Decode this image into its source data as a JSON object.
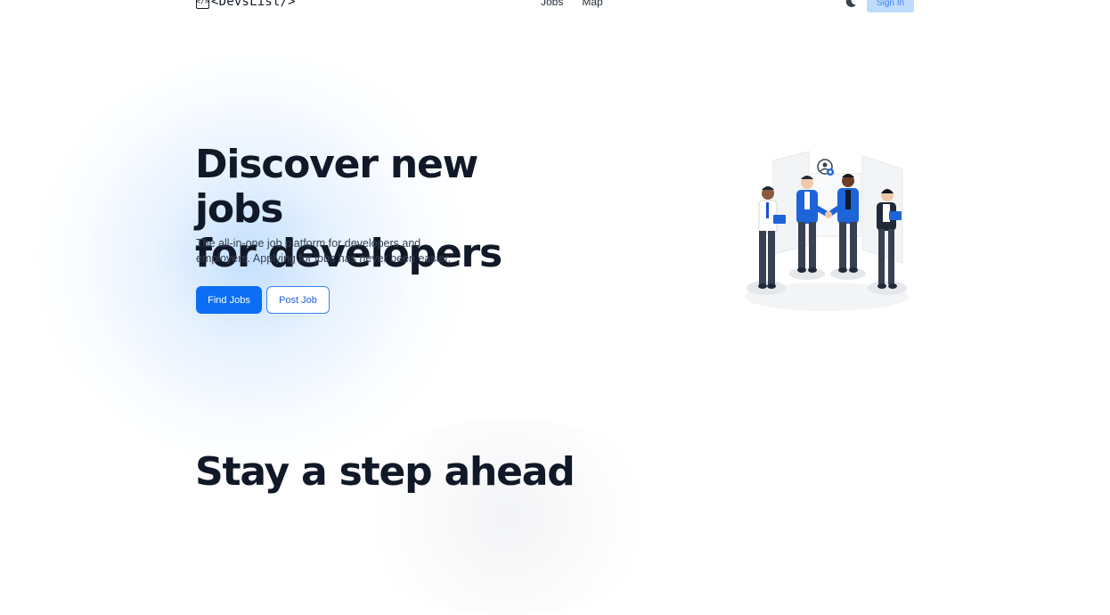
{
  "header": {
    "logo_icon": "</>",
    "logo_text": "<DevsList/>",
    "nav": [
      {
        "label": "Jobs"
      },
      {
        "label": "Map"
      }
    ],
    "theme_toggle_icon": "moon-icon",
    "signin_label": "Sign In"
  },
  "hero": {
    "title_line1": "Discover new jobs",
    "title_line2": "for developers",
    "subtitle": "The all-in-one job platform for developers and employers. Applying for jobs has never been easier.",
    "primary_button": "Find Jobs",
    "secondary_button": "Post Job",
    "illustration": "team-handshake-illustration"
  },
  "section": {
    "title": "Stay a step ahead"
  },
  "colors": {
    "primary": "#0b6ef5",
    "signin_bg": "#bfdbfe",
    "text_dark": "#111827"
  }
}
